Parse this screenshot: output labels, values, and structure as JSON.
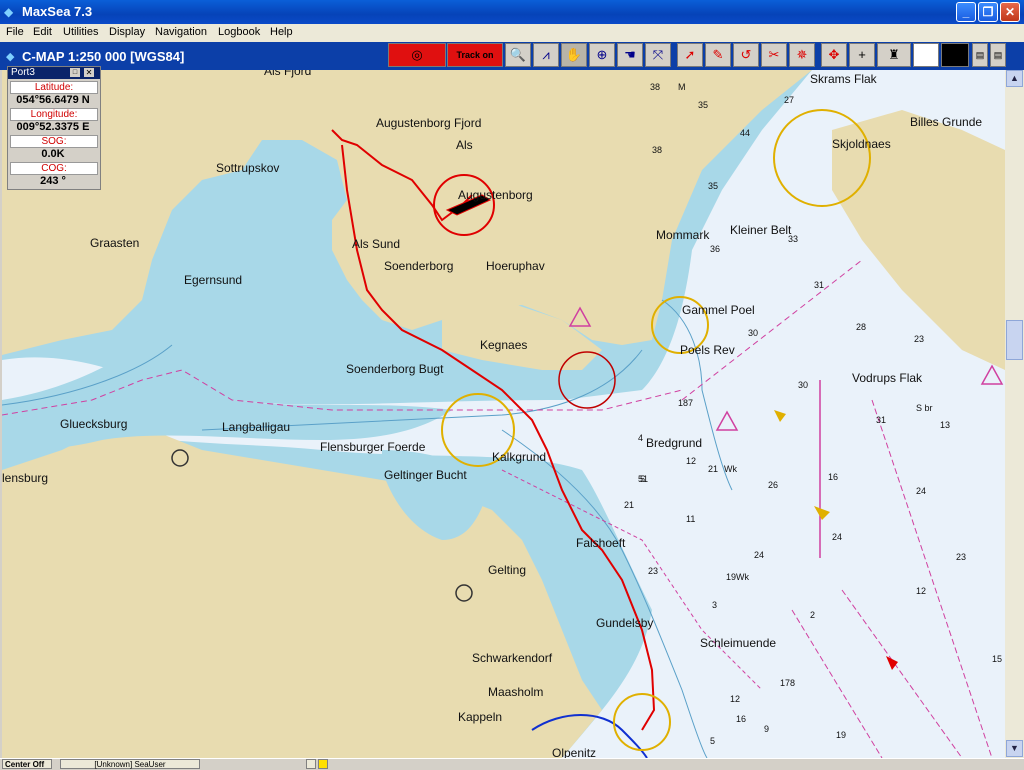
{
  "window": {
    "title": "MaxSea 7.3",
    "minimize": "_",
    "restore": "❐",
    "close": "✕"
  },
  "menu": [
    "File",
    "Edit",
    "Utilities",
    "Display",
    "Navigation",
    "Logbook",
    "Help"
  ],
  "chart_header": {
    "title": "C-MAP  1:250 000 [WGS84]",
    "track_label": "Track on"
  },
  "panel": {
    "title": "Port3",
    "latitude_label": "Latitude:",
    "latitude": "054°56.6479 N",
    "longitude_label": "Longitude:",
    "longitude": "009°52.3375 E",
    "sog_label": "SOG:",
    "sog": "0.0K",
    "cog_label": "COG:",
    "cog": "243 °"
  },
  "places": [
    "Als Fjord",
    "Augustenborg Fjord",
    "Als",
    "Sottrupskov",
    "Augustenborg",
    "Graasten",
    "Als Sund",
    "Soenderborg",
    "Hoeruphav",
    "Egernsund",
    "Mommark",
    "Kleiner Belt",
    "Skjoldnaes",
    "Billes Grunde",
    "Skrams Flak",
    "Gammel Poel",
    "Poels Rev",
    "Kegnaes",
    "Soenderborg Bugt",
    "Vodrups Flak",
    "Gluecksburg",
    "Langballigau",
    "Flensburger Foerde",
    "Kalkgrund",
    "Bredgrund",
    "Geltinger Bucht",
    "lensburg",
    "Falshoeft",
    "Gelting",
    "Gundelsby",
    "Schleimuende",
    "Schwarkendorf",
    "Maasholm",
    "Kappeln",
    "Olpenitz"
  ],
  "depths": [
    "38",
    "M",
    "35",
    "27",
    "44",
    "38",
    "35",
    "36",
    "33",
    "31",
    "28",
    "30",
    "23",
    "30",
    "31",
    "S br",
    "13",
    "18",
    "7",
    "4",
    "12",
    "21",
    "Wk",
    "26",
    "16",
    "24",
    "11",
    "21",
    "5",
    "51",
    "23",
    "24",
    "19",
    "Wk",
    "24",
    "23",
    "12",
    "3",
    "15",
    "2",
    "17",
    "8",
    "19",
    "16",
    "9",
    "12",
    "5"
  ],
  "status": {
    "left": "Center Off",
    "user": "[Unknown] SeaUser"
  },
  "colors": {
    "land": "#e8dcb0",
    "shallow": "#a8d8e8",
    "deep": "#eaf2fa",
    "track": "#e00000",
    "chart_header": "#0c3fa8"
  }
}
